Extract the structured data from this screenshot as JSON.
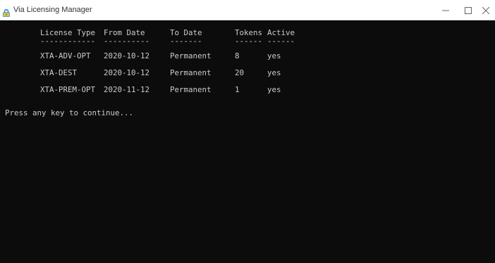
{
  "window": {
    "title": "Via Licensing Manager",
    "icon": "lock-icon",
    "controls": {
      "minimize": "—",
      "maximize": "☐",
      "close": "✕"
    },
    "colors": {
      "titlebar_bg": "#ffffff",
      "console_bg": "#0c0c0c",
      "console_text": "#cccccc",
      "icon_accent": "#1e8ad6",
      "icon_body": "#f2c230"
    }
  },
  "table": {
    "headers": [
      "License Type",
      "From Date",
      "To Date",
      "Tokens",
      "Active"
    ],
    "separators": [
      "------------",
      "----------",
      "-------",
      "------",
      "------"
    ],
    "rows": [
      [
        "XTA-ADV-OPT",
        "2020-10-12",
        "Permanent",
        "8",
        "yes"
      ],
      [
        "XTA-DEST",
        "2020-10-12",
        "Permanent",
        "20",
        "yes"
      ],
      [
        "XTA-PREM-OPT",
        "2020-11-12",
        "Permanent",
        "1",
        "yes"
      ]
    ]
  },
  "prompt": "Press any key to continue..."
}
